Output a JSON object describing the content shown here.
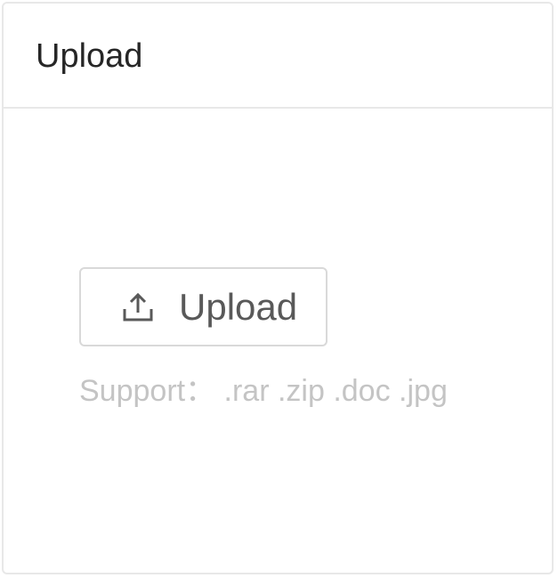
{
  "card": {
    "title": "Upload"
  },
  "upload": {
    "button_label": "Upload",
    "icon": "upload-icon",
    "hint": "Support： .rar .zip .doc .jpg"
  },
  "colors": {
    "border": "#e8e8e8",
    "button_border": "#d9d9d9",
    "title_text": "#262626",
    "button_text": "#595959",
    "hint_text": "#c4c4c4"
  }
}
